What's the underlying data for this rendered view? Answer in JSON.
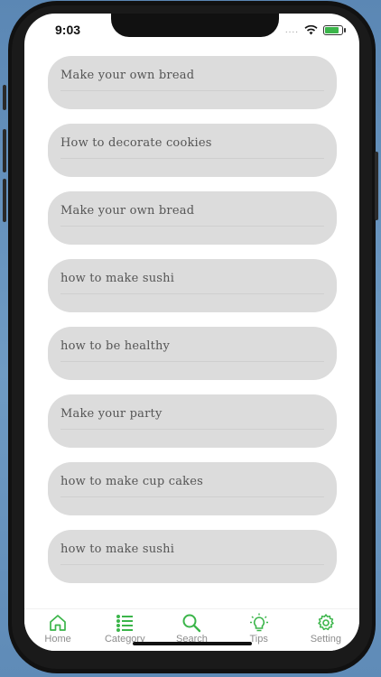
{
  "status_bar": {
    "time": "9:03",
    "signal_dots": "...."
  },
  "articles": [
    {
      "title": "Make your own bread"
    },
    {
      "title": "How to decorate cookies"
    },
    {
      "title": "Make your own bread"
    },
    {
      "title": "how to make sushi"
    },
    {
      "title": "how to be healthy"
    },
    {
      "title": "Make your party"
    },
    {
      "title": "how to make cup cakes"
    },
    {
      "title": "how to make sushi"
    }
  ],
  "tab_bar": {
    "accent_color": "#3bb54a",
    "tabs": [
      {
        "label": "Home",
        "icon": "home-icon"
      },
      {
        "label": "Category",
        "icon": "list-icon"
      },
      {
        "label": "Search",
        "icon": "search-icon"
      },
      {
        "label": "Tips",
        "icon": "lightbulb-icon"
      },
      {
        "label": "Setting",
        "icon": "gear-icon"
      }
    ]
  }
}
